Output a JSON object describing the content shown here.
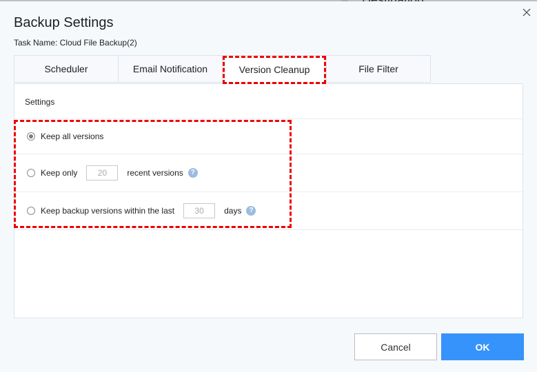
{
  "dialog": {
    "title": "Backup Settings",
    "task_name": "Task Name: Cloud File Backup(2)",
    "background_partial_text": "Destination",
    "close_icon": "close-icon"
  },
  "tabs": [
    {
      "label": "Scheduler",
      "active": false
    },
    {
      "label": "Email Notification",
      "active": false
    },
    {
      "label": "Version Cleanup",
      "active": true
    },
    {
      "label": "File Filter",
      "active": false
    }
  ],
  "panel": {
    "section_label": "Settings",
    "options": [
      {
        "label": "Keep all versions",
        "selected": true
      },
      {
        "label_before": "Keep only",
        "value": "20",
        "label_after": "recent versions",
        "selected": false,
        "help_icon": "question-icon"
      },
      {
        "label_before": "Keep backup versions within the last",
        "value": "30",
        "label_after": "days",
        "selected": false,
        "help_icon": "question-icon"
      }
    ]
  },
  "buttons": {
    "cancel": "Cancel",
    "ok": "OK"
  },
  "help_glyph": "?",
  "colors": {
    "accent": "#3593fb",
    "highlight_dash": "#ee0000",
    "help_icon": "#9dbbe0"
  }
}
